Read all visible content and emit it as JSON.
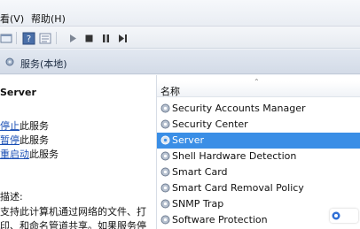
{
  "menu": {
    "view": "看(V)",
    "help": "帮助(H)"
  },
  "toolbar": {
    "icons": [
      "console-icon",
      "help-icon",
      "properties-icon",
      "play-icon",
      "stop-icon",
      "pause-icon",
      "restart-icon"
    ]
  },
  "header": {
    "title": "服务(本地)"
  },
  "detail": {
    "service_name": "Server",
    "actions": [
      {
        "link": "停止",
        "text": "此服务"
      },
      {
        "link": "暂停",
        "text": "此服务"
      },
      {
        "link": "重启动",
        "text": "此服务"
      }
    ],
    "description_label": "描述:",
    "description_lines": [
      "支持此计算机通过网络的文件、打",
      "印、和命名管道共享。如果服务停"
    ]
  },
  "list": {
    "column_name": "名称",
    "selected_index": 2,
    "services": [
      "Security Accounts Manager",
      "Security Center",
      "Server",
      "Shell Hardware Detection",
      "Smart Card",
      "Smart Card Removal Policy",
      "SNMP Trap",
      "Software Protection"
    ]
  },
  "colors": {
    "selection": "#3a8ee6",
    "link": "#1a4fb5"
  }
}
